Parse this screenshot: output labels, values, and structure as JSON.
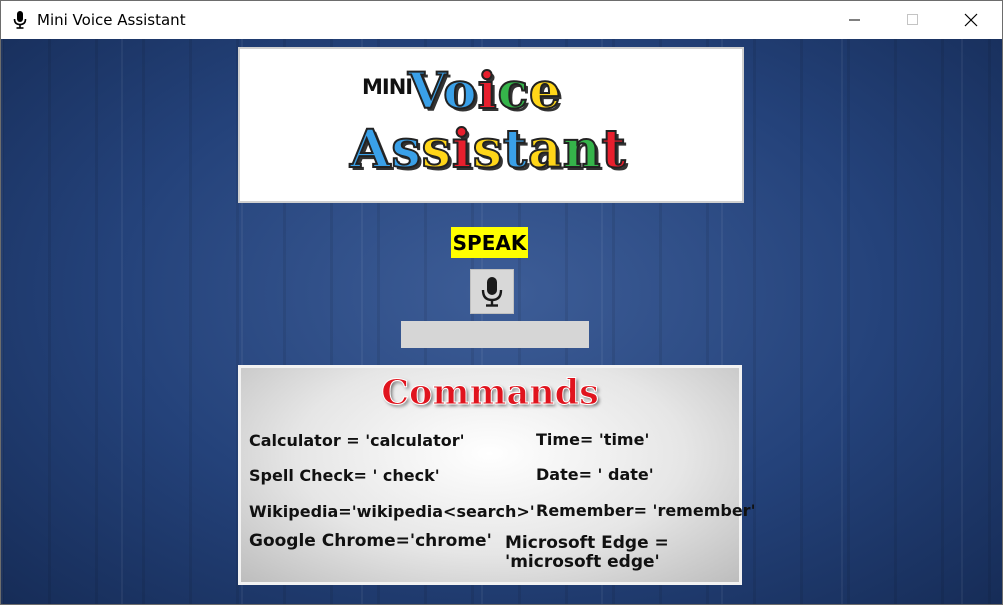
{
  "window": {
    "title": "Mini Voice Assistant",
    "title_icon": "microphone-icon",
    "controls": [
      "minimize-icon",
      "maximize-icon",
      "close-icon"
    ]
  },
  "logo": {
    "mini": "MINI",
    "voice": [
      "V",
      "o",
      "i",
      "c",
      "e"
    ],
    "assistant": [
      "A",
      "s",
      "s",
      "i",
      "s",
      "t",
      "a",
      "n",
      "t"
    ],
    "colors": {
      "blue": "#3aa0e8",
      "yellow": "#ffd619",
      "red": "#e81f2d",
      "green": "#35b44a"
    }
  },
  "speak": {
    "label": "SPEAK",
    "background": "#ffff00"
  },
  "mic_button": {
    "icon": "microphone-icon"
  },
  "result": {
    "value": ""
  },
  "commands": {
    "title": "Commands",
    "title_color": "#e0141e",
    "left": [
      "Calculator = 'calculator'",
      "Spell Check= ' check'",
      "Wikipedia='wikipedia<search>'",
      "Google Chrome='chrome'"
    ],
    "right": [
      "Time= 'time'",
      "Date= ' date'",
      "Remember= 'remember'",
      "Microsoft Edge = 'microsoft edge'"
    ]
  },
  "colors": {
    "background": "#24427a",
    "panel": "#ffffff"
  }
}
